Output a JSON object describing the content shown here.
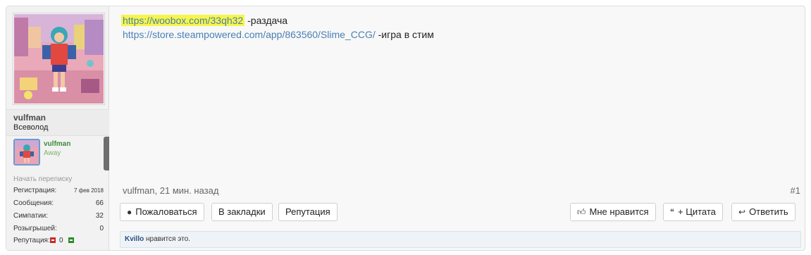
{
  "user": {
    "username": "vulfman",
    "title": "Всеволод",
    "mini_card": {
      "name": "vulfman",
      "status": "Away"
    },
    "start_conversation": "Начать переписку",
    "stats": [
      {
        "label": "Регистрация:",
        "value": "7 фев 2018"
      },
      {
        "label": "Сообщения:",
        "value": "66"
      },
      {
        "label": "Симпатии:",
        "value": "32"
      },
      {
        "label": "Розыгрышей:",
        "value": "0"
      }
    ],
    "reputation": {
      "label": "Репутация:",
      "value": "0"
    }
  },
  "post": {
    "lines": [
      {
        "link": "https://woobox.com/33qh32",
        "text": " -раздача"
      },
      {
        "link": "https://store.steampowered.com/app/863560/Slime_CCG/",
        "text": " -игра в стим"
      }
    ],
    "meta": "vulfman, 21 мин. назад",
    "number": "#1",
    "left_buttons": [
      {
        "label": "Пожаловаться",
        "icon": "alert-icon"
      },
      {
        "label": "В закладки"
      },
      {
        "label": "Репутация"
      }
    ],
    "right_buttons": [
      {
        "label": "Мне нравится",
        "icon": "thumbs-up-icon"
      },
      {
        "label": "+ Цитата",
        "icon": "quote-icon"
      },
      {
        "label": "Ответить",
        "icon": "reply-icon"
      }
    ],
    "likes": {
      "who": "Kvillo",
      "text": " нравится это."
    }
  },
  "colors": {
    "link": "#4a7fb5",
    "highlight": "#f7f54a",
    "online_green": "#3c8a3c"
  }
}
